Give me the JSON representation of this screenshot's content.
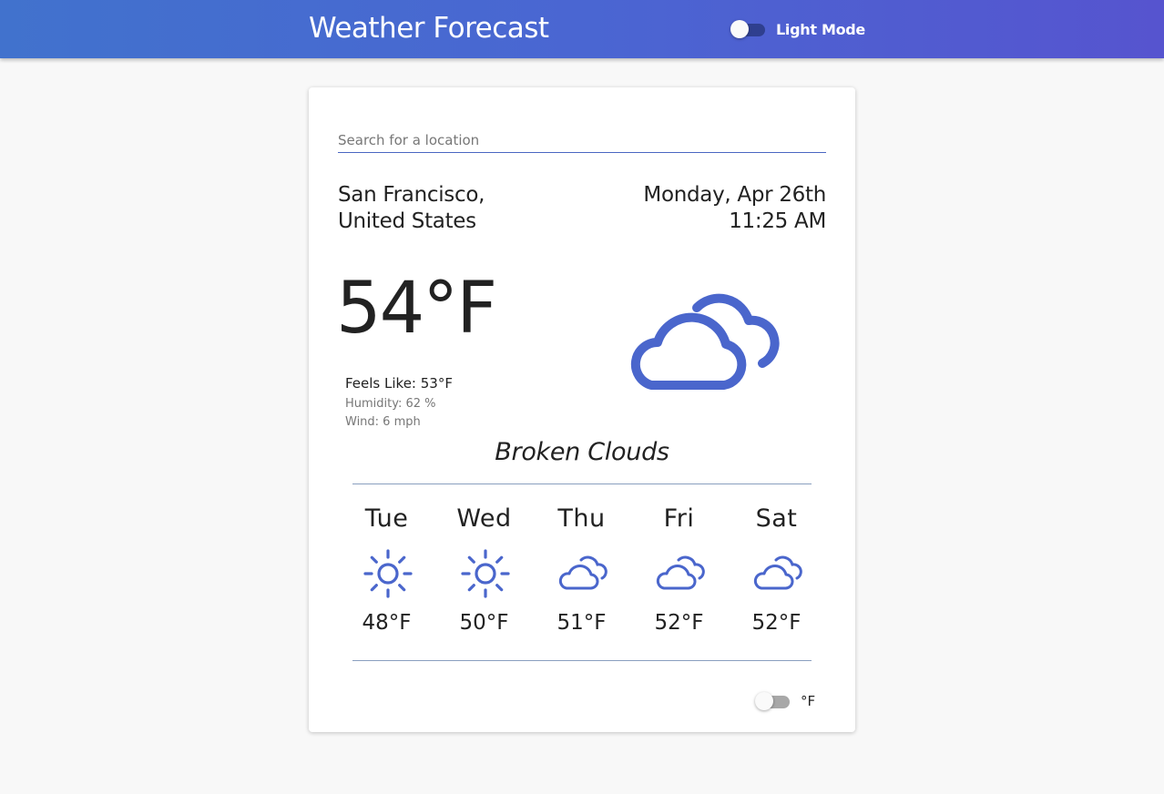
{
  "header": {
    "title": "Weather Forecast",
    "mode_label": "Light Mode",
    "mode_on": false
  },
  "search": {
    "placeholder": "Search for a location",
    "value": ""
  },
  "location": {
    "city": "San Francisco,",
    "country": "United States"
  },
  "datetime": {
    "date": "Monday, Apr 26th",
    "time": "11:25 AM"
  },
  "current": {
    "temperature": "54°F",
    "feels_like": "Feels Like: 53°F",
    "humidity": "Humidity: 62 %",
    "wind": "Wind: 6 mph",
    "condition": "Broken Clouds",
    "icon": "broken-clouds-icon"
  },
  "forecast": [
    {
      "day": "Tue",
      "temp": "48°F",
      "icon": "sun-icon"
    },
    {
      "day": "Wed",
      "temp": "50°F",
      "icon": "sun-icon"
    },
    {
      "day": "Thu",
      "temp": "51°F",
      "icon": "broken-clouds-icon"
    },
    {
      "day": "Fri",
      "temp": "52°F",
      "icon": "broken-clouds-icon"
    },
    {
      "day": "Sat",
      "temp": "52°F",
      "icon": "broken-clouds-icon"
    }
  ],
  "units": {
    "label": "°F",
    "toggle_on": false
  },
  "colors": {
    "accent": "#4a66d2",
    "icon": "#4a66cc"
  }
}
